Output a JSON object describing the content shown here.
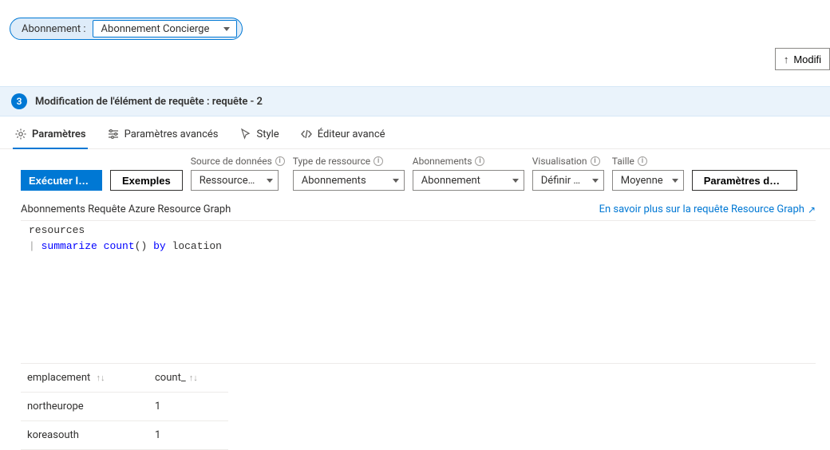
{
  "subscription": {
    "label": "Abonnement :",
    "value": "Abonnement Concierge"
  },
  "top_right": {
    "modify_label": "Modifi"
  },
  "section": {
    "step_number": "3",
    "title": "Modification de l'élément de requête : requête - 2"
  },
  "tabs": {
    "parameters": "Paramètres",
    "advanced_parameters": "Paramètres avancés",
    "style": "Style",
    "advanced_editor": "Éditeur avancé"
  },
  "controls": {
    "run_query": "Exécuter la req...",
    "examples": "Exemples",
    "data_source_label": "Source de données",
    "data_source_value": "Ressources Az...",
    "resource_type_label": "Type de ressource",
    "resource_type_value": "Abonnements",
    "subscriptions_label": "Abonnements",
    "subscriptions_value": "Abonnement",
    "visualization_label": "Visualisation",
    "visualization_value": "Définir pa...",
    "size_label": "Taille",
    "size_value": "Moyenne",
    "column_settings": "Paramètres de co..."
  },
  "query_info": {
    "description": "Abonnements Requête Azure Resource Graph",
    "learn_more": "En savoir plus sur la requête Resource Graph"
  },
  "code": {
    "line1": "resources",
    "pipe": "|",
    "summarize": "summarize",
    "count_fn": "count",
    "parens": "()",
    "by_kw": "by",
    "location_kw": "location"
  },
  "results": {
    "col_location": "emplacement",
    "col_count": "count_",
    "rows": [
      {
        "location": "northeurope",
        "count": "1"
      },
      {
        "location": "koreasouth",
        "count": "1"
      }
    ]
  }
}
